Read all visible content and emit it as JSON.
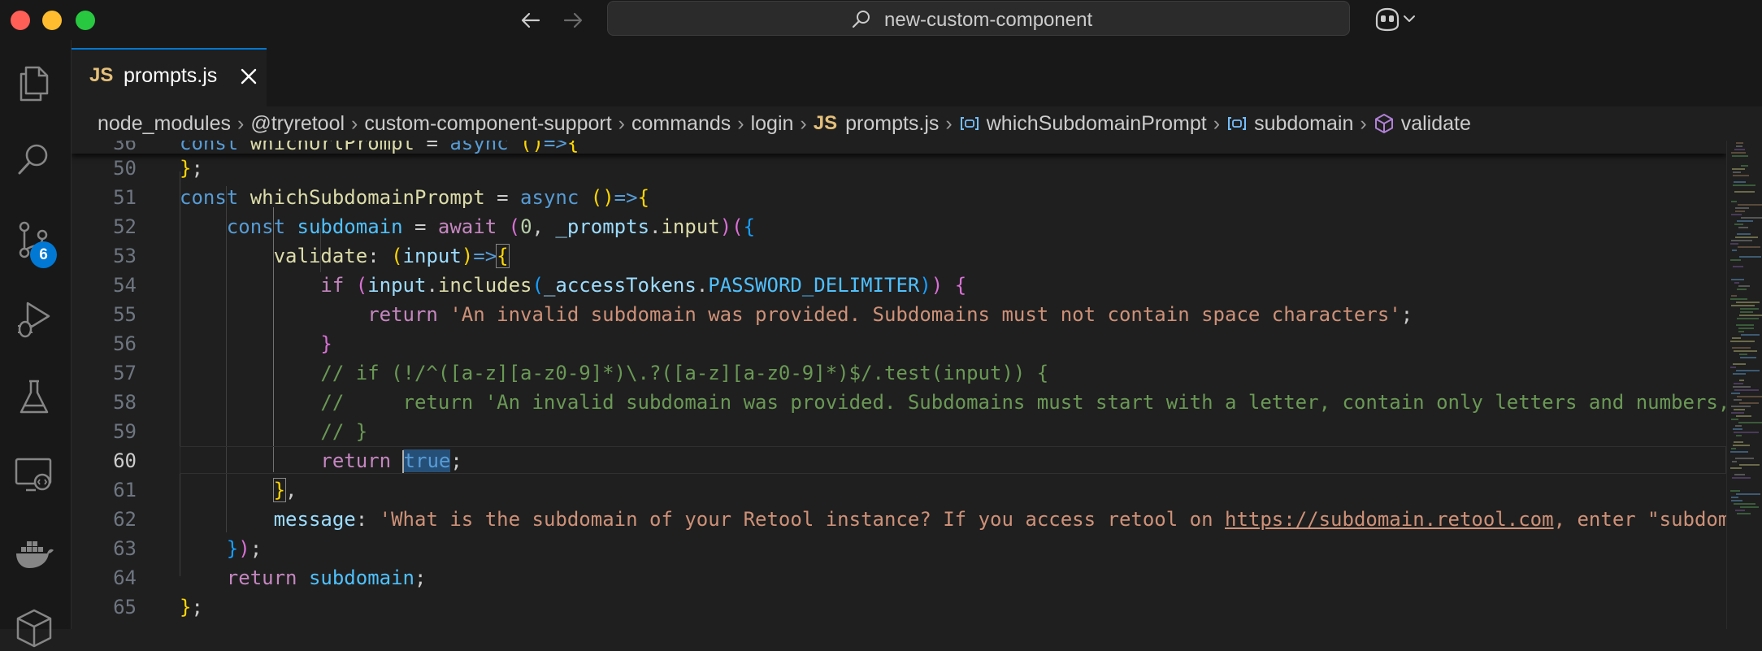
{
  "titlebar": {
    "search_text": "new-custom-component"
  },
  "activity_bar": {
    "source_control_badge": "6"
  },
  "tabs": [
    {
      "icon_text": "JS",
      "label": "prompts.js"
    }
  ],
  "breadcrumbs": [
    {
      "label": "node_modules",
      "icon": "none"
    },
    {
      "label": "@tryretool",
      "icon": "none"
    },
    {
      "label": "custom-component-support",
      "icon": "none"
    },
    {
      "label": "commands",
      "icon": "none"
    },
    {
      "label": "login",
      "icon": "none"
    },
    {
      "label": "prompts.js",
      "icon": "js-file-icon",
      "icon_text": "JS"
    },
    {
      "label": "whichSubdomainPrompt",
      "icon": "variable-icon"
    },
    {
      "label": "subdomain",
      "icon": "variable-icon"
    },
    {
      "label": "validate",
      "icon": "method-icon"
    }
  ],
  "editor": {
    "sticky_line": {
      "number": "36",
      "text": "const whichUrlPrompt = async ()=>{"
    },
    "active_line": "60",
    "lines": [
      {
        "number": "50"
      },
      {
        "number": "51"
      },
      {
        "number": "52"
      },
      {
        "number": "53"
      },
      {
        "number": "54"
      },
      {
        "number": "55"
      },
      {
        "number": "56"
      },
      {
        "number": "57"
      },
      {
        "number": "58"
      },
      {
        "number": "59"
      },
      {
        "number": "60"
      },
      {
        "number": "61"
      },
      {
        "number": "62"
      },
      {
        "number": "63"
      },
      {
        "number": "64"
      },
      {
        "number": "65"
      }
    ],
    "tokens": {
      "const": "const",
      "async": "async",
      "await": "await",
      "if": "if",
      "return": "return",
      "true": "true",
      "whichUrlPrompt": "whichUrlPrompt",
      "whichSubdomainPrompt": "whichSubdomainPrompt",
      "subdomain": "subdomain",
      "zero": "0",
      "prompts": "_prompts",
      "input_fn": "input",
      "validate_key": "validate",
      "input_param": "input",
      "includes": "includes",
      "accessTokens": "_accessTokens",
      "password_delim": "PASSWORD_DELIMITER",
      "msg_space": "'An invalid subdomain was provided. Subdomains must not contain space characters'",
      "comment_57": "// if (!/^([a-z][a-z0-9]*)\\.?([a-z][a-z0-9]*)$/.test(input)) {",
      "comment_58": "//     return 'An invalid subdomain was provided. Subdomains must start with a letter, contain only letters and numbers,",
      "comment_59": "// }",
      "message_key": "message",
      "message_str_a": "'What is the subdomain of your Retool instance? If you access retool on ",
      "message_link": "https://subdomain.retool.com",
      "message_str_b": ", enter \"subdom"
    }
  },
  "colors": {
    "editor_bg": "#1f1f1f",
    "chrome_bg": "#181818",
    "accent": "#0078d4",
    "keyword": "#569cd6",
    "string": "#ce9178",
    "comment": "#6a9955",
    "function": "#dcdcaa",
    "variable": "#9cdcfe"
  }
}
